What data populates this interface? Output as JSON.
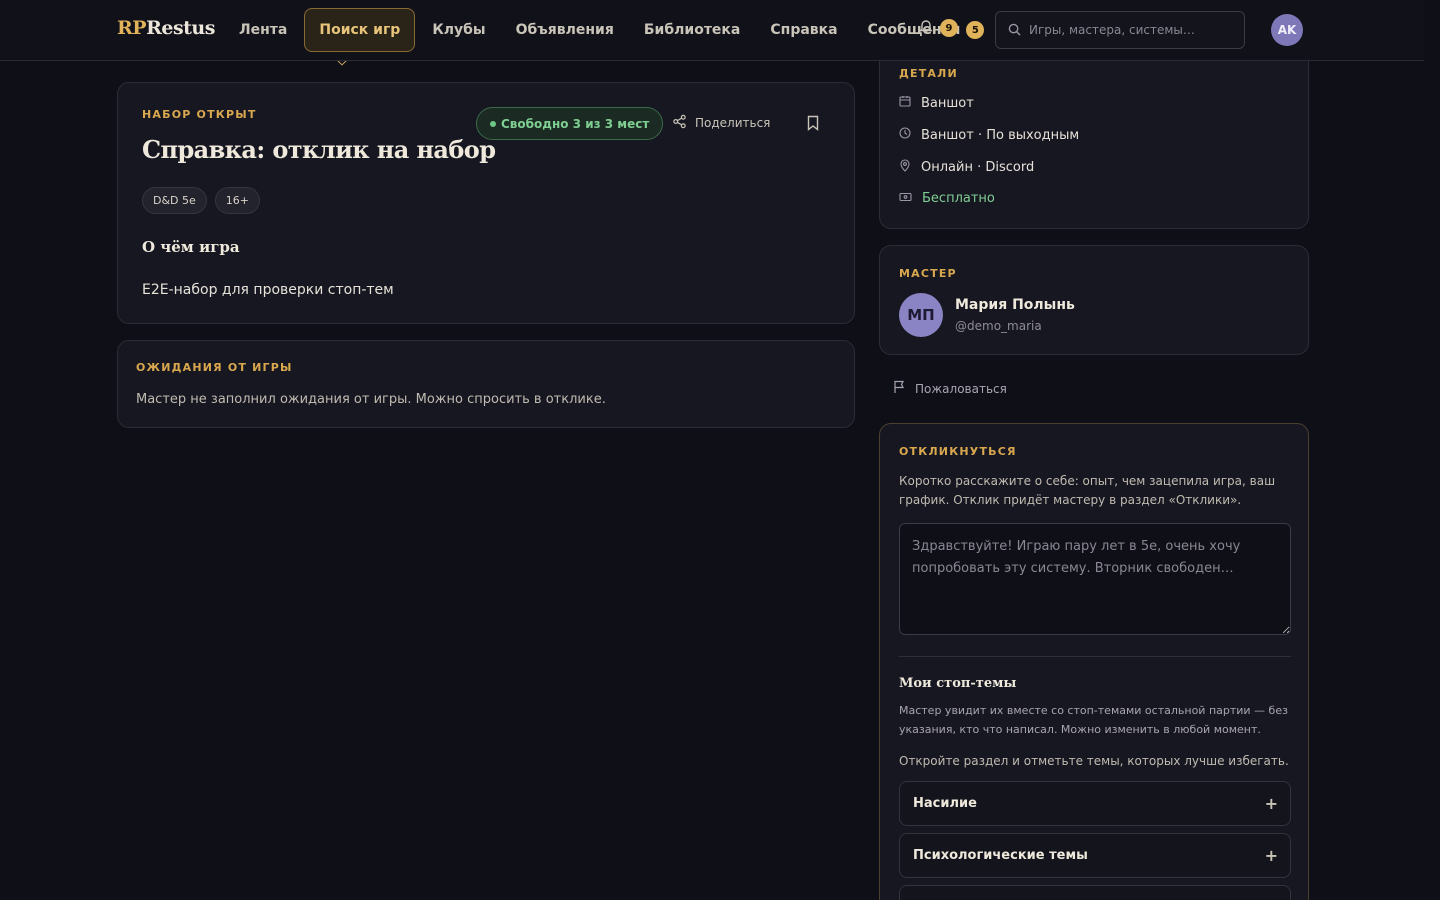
{
  "brand": {
    "part1": "RP",
    "part2": "Restus"
  },
  "nav": {
    "items": [
      {
        "label": "Лента"
      },
      {
        "label": "Поиск игр"
      },
      {
        "label": "Клубы"
      },
      {
        "label": "Объявления"
      },
      {
        "label": "Библиотека"
      },
      {
        "label": "Справка"
      },
      {
        "label": "Сообщения",
        "badge": "5"
      }
    ],
    "notifications_badge": "9",
    "search_placeholder": "Игры, мастера, системы…",
    "user_initials": "AK"
  },
  "game": {
    "status": "Набор открыт",
    "title": "Справка: отклик на набор",
    "free_slots": "Свободно 3 из 3 мест",
    "share_label": "Поделиться",
    "tags": [
      "D&D 5e",
      "16+"
    ],
    "about_heading": "О чём игра",
    "about_text": "E2E-набор для проверки стоп-тем"
  },
  "expectations": {
    "heading": "Ожидания от игры",
    "text": "Мастер не заполнил ожидания от игры. Можно спросить в отклике."
  },
  "details": {
    "heading": "Детали",
    "rows": [
      {
        "icon": "calendar-icon",
        "text": "Ваншот"
      },
      {
        "icon": "clock-icon",
        "text": "Ваншот · По выходным"
      },
      {
        "icon": "location-pin-icon",
        "text": "Онлайн · Discord"
      },
      {
        "icon": "ticket-icon",
        "text": "Бесплатно"
      }
    ]
  },
  "master": {
    "heading": "Мастер",
    "initials": "МП",
    "name": "Мария Полынь",
    "handle": "@demo_maria"
  },
  "report_label": "Пожаловаться",
  "reply": {
    "heading": "Откликнуться",
    "description": "Коротко расскажите о себе: опыт, чем зацепила игра, ваш график. Отклик придёт мастеру в раздел «Отклики».",
    "placeholder": "Здравствуйте! Играю пару лет в 5е, очень хочу попробовать эту систему. Вторник свободен…",
    "stop_heading": "Мои стоп-темы",
    "stop_description": "Мастер увидит их вместе со стоп-темами остальной партии — без указания, кто что написал. Можно изменить в любой момент.",
    "stop_hint": "Откройте раздел и отметьте темы, которых лучше избегать.",
    "sections": [
      {
        "label": "Насилие"
      },
      {
        "label": "Психологические темы"
      }
    ]
  },
  "colors": {
    "accent": "#e0b25a",
    "success": "#7fce92",
    "background": "#0f0f18",
    "card": "#171722"
  }
}
